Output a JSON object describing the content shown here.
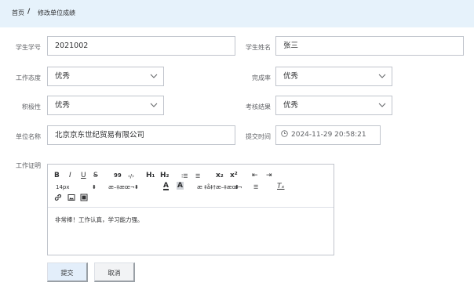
{
  "breadcrumb": {
    "home": "首页",
    "separator": "/",
    "current": "修改单位成绩"
  },
  "form": {
    "student_id": {
      "label": "学生学号",
      "value": "2021002"
    },
    "student_name": {
      "label": "学生姓名",
      "value": "张三"
    },
    "work_attitude": {
      "label": "工作态度",
      "value": "优秀"
    },
    "completion_rate": {
      "label": "完成率",
      "value": "优秀"
    },
    "initiative": {
      "label": "积极性",
      "value": "优秀"
    },
    "assessment_result": {
      "label": "考核结果",
      "value": "优秀"
    },
    "unit_name": {
      "label": "单位名称",
      "value": "北京京东世纪贸易有限公司"
    },
    "submit_time": {
      "label": "提交时间",
      "value": "2024-11-29 20:58:21"
    },
    "work_proof": {
      "label": "工作证明"
    }
  },
  "editor": {
    "toolbar": {
      "bold": "B",
      "italic": "I",
      "underline": "U",
      "strike": "S",
      "quote": "99",
      "code": "‹/›",
      "h1": "H₁",
      "h2": "H₂",
      "ordered_list": "⁝☰",
      "bullet_list": "☰",
      "subscript": "x₂",
      "superscript": "x²",
      "outdent": "⇤",
      "indent": "⇥",
      "font_size": "14px",
      "font_size_arrow": "⬍",
      "font_family": "æ–‡æœ¬",
      "font_family_arrow": "⬍",
      "font_color": "A",
      "background_color": "A",
      "header_select": "æ ‡å‡†æ–‡æœ¬",
      "header_select_arrow": "⬍",
      "align": "☰",
      "clean": "Tₓ"
    },
    "content": "非常棒！工作认真，学习能力强。"
  },
  "buttons": {
    "submit": "提交",
    "cancel": "取消"
  },
  "colors": {
    "topbar": "#e6f2fb",
    "border": "#c0c4cc",
    "primary_button": "#e3eefa"
  }
}
